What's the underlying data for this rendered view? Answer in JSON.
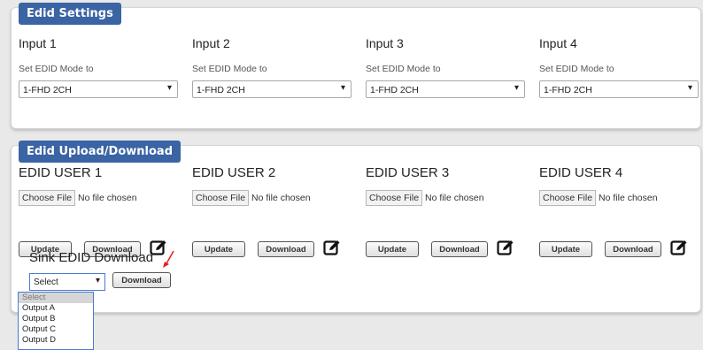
{
  "edid_settings": {
    "tab_label": "Edid Settings",
    "mode_label": "Set EDID Mode to",
    "inputs": [
      {
        "title": "Input 1",
        "value": "1-FHD 2CH"
      },
      {
        "title": "Input 2",
        "value": "1-FHD 2CH"
      },
      {
        "title": "Input 3",
        "value": "1-FHD 2CH"
      },
      {
        "title": "Input 4",
        "value": "1-FHD 2CH"
      }
    ]
  },
  "edid_upload": {
    "tab_label": "Edid Upload/Download",
    "users": [
      {
        "title": "EDID USER 1",
        "choose": "Choose File",
        "nofile": "No file chosen"
      },
      {
        "title": "EDID USER 2",
        "choose": "Choose File",
        "nofile": "No file chosen"
      },
      {
        "title": "EDID USER 3",
        "choose": "Choose File",
        "nofile": "No file chosen"
      },
      {
        "title": "EDID USER 4",
        "choose": "Choose File",
        "nofile": "No file chosen"
      }
    ],
    "update_label": "Update",
    "download_label": "Download",
    "edit_icon": "edit-icon",
    "sink": {
      "title": "Sink EDID Download",
      "select_value": "Select",
      "download_label": "Download",
      "options": [
        "Select",
        "Output A",
        "Output B",
        "Output C",
        "Output D"
      ]
    }
  },
  "colors": {
    "tab_bg": "#3a64a4",
    "annotation_arrow": "#e02020"
  }
}
